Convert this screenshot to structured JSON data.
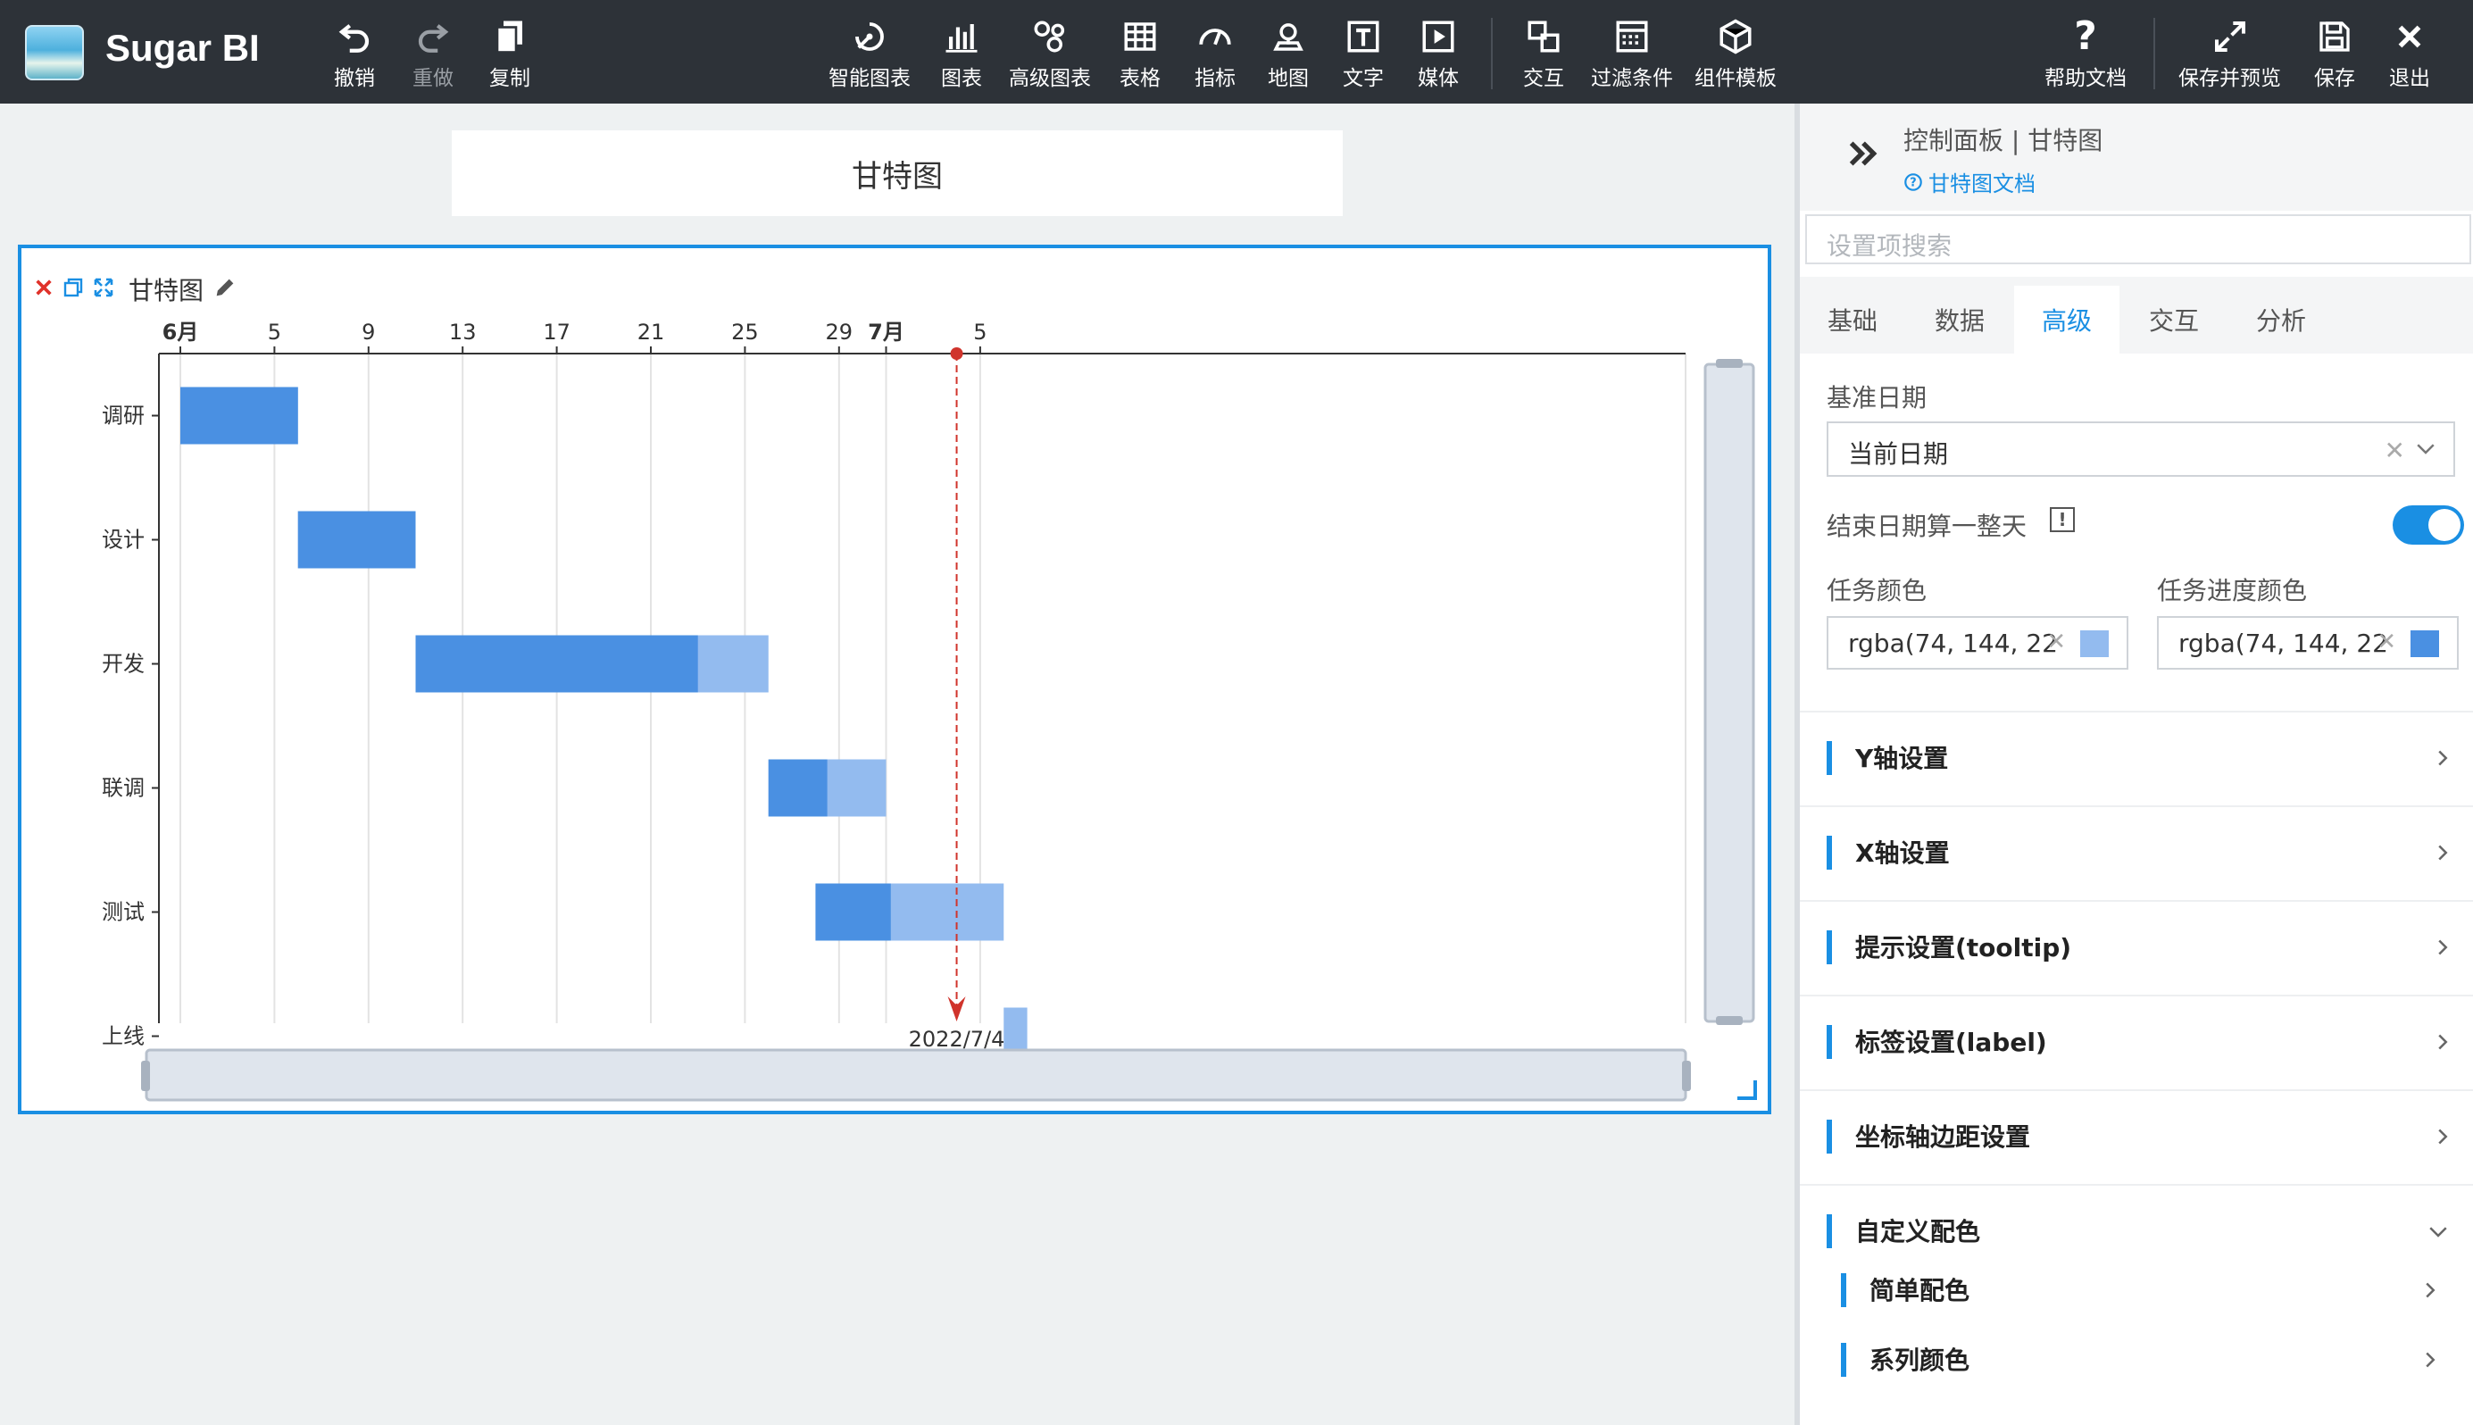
{
  "app": {
    "name": "Sugar BI"
  },
  "toolbar": {
    "undo": "撤销",
    "redo": "重做",
    "copy": "复制",
    "smart_chart": "智能图表",
    "chart": "图表",
    "advanced_chart": "高级图表",
    "table": "表格",
    "indicator": "指标",
    "map": "地图",
    "text": "文字",
    "media": "媒体",
    "interaction": "交互",
    "filter": "过滤条件",
    "template": "组件模板",
    "help": "帮助文档",
    "save_preview": "保存并预览",
    "save": "保存",
    "exit": "退出"
  },
  "title_card": {
    "text": "甘特图"
  },
  "widget": {
    "title": "甘特图"
  },
  "chart_data": {
    "type": "gantt",
    "x_tick_labels": [
      "6月",
      "5",
      "9",
      "13",
      "17",
      "21",
      "25",
      "29",
      "7月",
      "5"
    ],
    "x_tick_dates": [
      "2022-06-01",
      "2022-06-05",
      "2022-06-09",
      "2022-06-13",
      "2022-06-17",
      "2022-06-21",
      "2022-06-25",
      "2022-06-29",
      "2022-07-01",
      "2022-07-05"
    ],
    "x_range": [
      "2022-06-01",
      "2022-07-07"
    ],
    "tasks": [
      {
        "name": "调研",
        "start": "2022-06-01",
        "end": "2022-06-06",
        "progress_end": "2022-06-06"
      },
      {
        "name": "设计",
        "start": "2022-06-06",
        "end": "2022-06-11",
        "progress_end": "2022-06-11"
      },
      {
        "name": "开发",
        "start": "2022-06-11",
        "end": "2022-06-26",
        "progress_end": "2022-06-23"
      },
      {
        "name": "联调",
        "start": "2022-06-26",
        "end": "2022-07-01",
        "progress_end": "2022-06-28.5"
      },
      {
        "name": "测试",
        "start": "2022-06-28",
        "end": "2022-07-06",
        "progress_end": "2022-07-01.2"
      },
      {
        "name": "上线",
        "start": "2022-07-06",
        "end": "2022-07-07",
        "progress_end": "2022-07-06"
      }
    ],
    "today_marker": "2022/7/4",
    "today_date": "2022-07-04",
    "colors": {
      "progress": "#4a90e2",
      "task": "#93bbef",
      "marker": "#d0342c"
    },
    "grid": true
  },
  "panel": {
    "title": "控制面板 | 甘特图",
    "doc_link": "甘特图文档",
    "search_placeholder": "设置项搜索",
    "tabs": [
      "基础",
      "数据",
      "高级",
      "交互",
      "分析"
    ],
    "active_tab": "高级",
    "base_date_label": "基准日期",
    "base_date_value": "当前日期",
    "end_date_full_day_label": "结束日期算一整天",
    "end_date_full_day_on": true,
    "task_color_label": "任务颜色",
    "task_color_value": "rgba(74, 144, 22",
    "task_color_swatch": "#93bbef",
    "progress_color_label": "任务进度颜色",
    "progress_color_value": "rgba(74, 144, 22",
    "progress_color_swatch": "#4a90e2",
    "sections": [
      "Y轴设置",
      "X轴设置",
      "提示设置(tooltip)",
      "标签设置(label)",
      "坐标轴边距设置",
      "自定义配色"
    ],
    "sub_sections": [
      "简单配色",
      "系列颜色"
    ]
  }
}
